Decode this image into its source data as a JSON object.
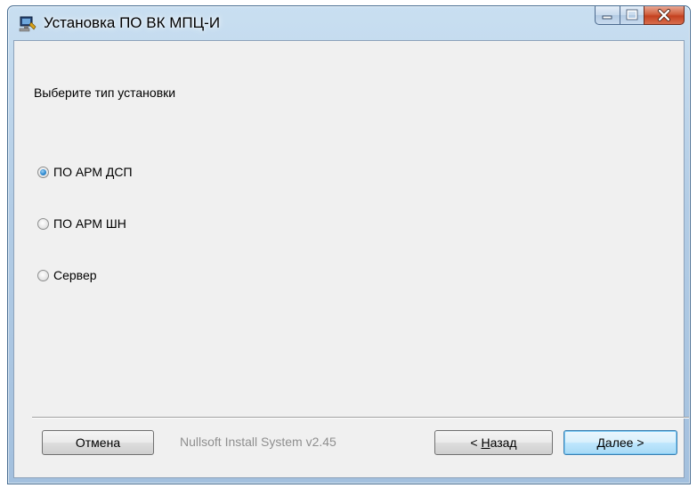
{
  "window": {
    "title": "Установка ПО ВК МПЦ-И",
    "icon": "installer-app-icon",
    "caption_buttons": [
      "minimize",
      "maximize",
      "close"
    ]
  },
  "page": {
    "heading": "Выберите тип установки"
  },
  "options": [
    {
      "label": "ПО АРМ ДСП",
      "checked": true
    },
    {
      "label": "ПО АРМ ШН",
      "checked": false
    },
    {
      "label": "Сервер",
      "checked": false
    }
  ],
  "footer": {
    "cancel_label": "Отмена",
    "branding": "Nullsoft Install System v2.45",
    "back_prefix": "< ",
    "back_mnemonic": "Н",
    "back_rest": "азад",
    "next_label": "Далее >"
  },
  "colors": {
    "title_gradient_top": "#c9dff1",
    "content_bg": "#f0f0f0",
    "close_button": "#c4401f",
    "branding_text": "#8f8f8f",
    "radio_checked": "#2d8ad1"
  }
}
